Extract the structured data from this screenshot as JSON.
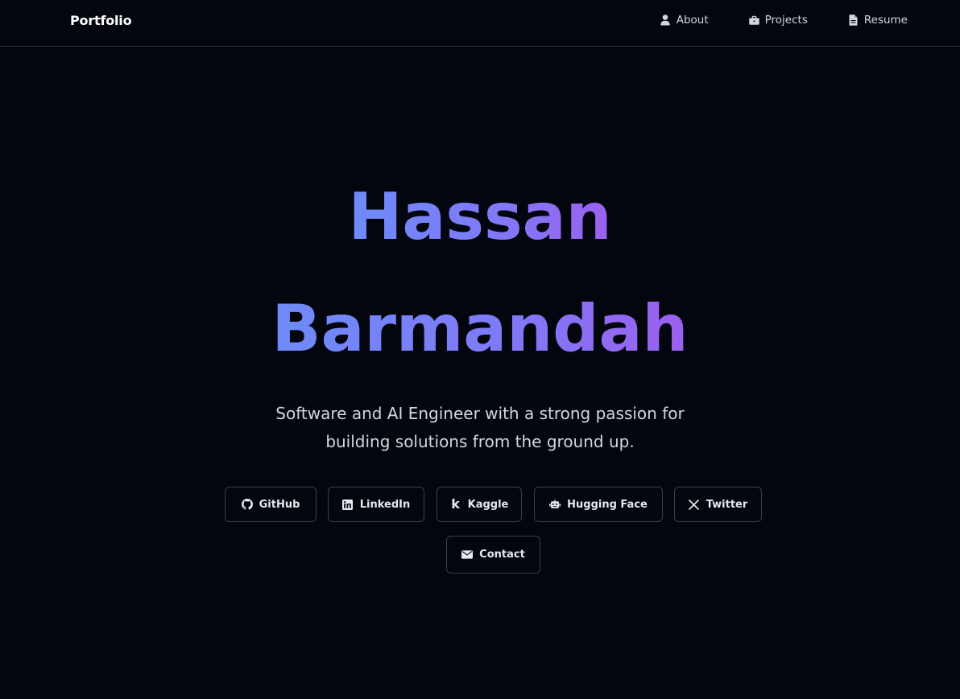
{
  "navbar": {
    "brand": "Portfolio",
    "links": [
      {
        "label": "About",
        "icon": "user-icon"
      },
      {
        "label": "Projects",
        "icon": "briefcase-icon"
      },
      {
        "label": "Resume",
        "icon": "file-icon"
      }
    ]
  },
  "hero": {
    "name_line_1": "Hassan",
    "name_line_2": "Barmandah",
    "tagline_line_1": "Software and AI Engineer with a strong passion for",
    "tagline_line_2": "building solutions from the ground up.",
    "gradient_colors": [
      "#6d89f8",
      "#9b62ef"
    ]
  },
  "social_buttons": [
    {
      "label": "GitHub",
      "icon": "github-icon"
    },
    {
      "label": "LinkedIn",
      "icon": "linkedin-icon"
    },
    {
      "label": "Kaggle",
      "icon": "kaggle-icon"
    },
    {
      "label": "Hugging Face",
      "icon": "robot-icon"
    },
    {
      "label": "Twitter",
      "icon": "x-icon"
    },
    {
      "label": "Contact",
      "icon": "envelope-icon"
    }
  ],
  "colors": {
    "background": "#03060f",
    "border": "#3a3f4b",
    "text": "#d3d6dc"
  }
}
